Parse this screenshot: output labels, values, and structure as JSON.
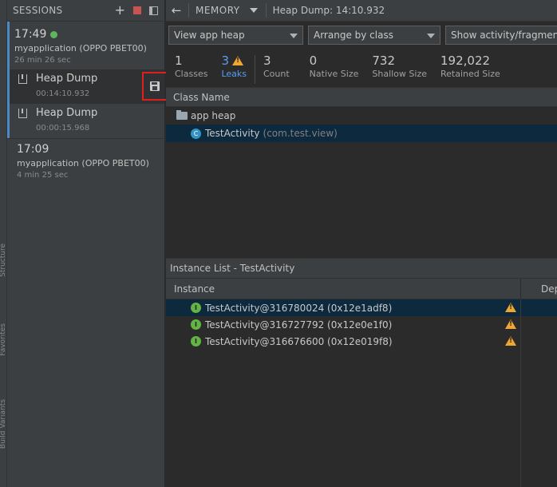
{
  "sessions_panel": {
    "title": "SESSIONS",
    "icons": [
      "plus-icon",
      "stop-icon",
      "panel-icon"
    ],
    "sessions": [
      {
        "time": "17:49",
        "device": "myapplication (OPPO PBET00)",
        "age": "26 min 26 sec",
        "live": true,
        "dumps": [
          {
            "title": "Heap Dump",
            "duration": "00:14:10.932"
          },
          {
            "title": "Heap Dump",
            "duration": "00:00:15.968"
          }
        ]
      },
      {
        "time": "17:09",
        "device": "myapplication (OPPO PBET00)",
        "age": "4 min 25 sec"
      }
    ]
  },
  "toolbar": {
    "profiler": "MEMORY",
    "dump_title": "Heap Dump: 14:10.932"
  },
  "filters": {
    "heap": "View app heap",
    "arrange": "Arrange by class",
    "activity": "Show activity/fragment Leaks"
  },
  "stats": [
    {
      "value": "1",
      "label": "Classes"
    },
    {
      "value": "3",
      "label": "Leaks",
      "warning": true
    },
    {
      "value": "3",
      "label": "Count"
    },
    {
      "value": "0",
      "label": "Native Size"
    },
    {
      "value": "732",
      "label": "Shallow Size"
    },
    {
      "value": "192,022",
      "label": "Retained Size"
    }
  ],
  "class_table": {
    "header": "Class Name",
    "group": "app heap",
    "class_name": "TestActivity",
    "class_package": "(com.test.view)"
  },
  "instance_list": {
    "title": "Instance List - TestActivity",
    "columns": [
      "Instance",
      "Dep"
    ],
    "rows": [
      "TestActivity@316780024 (0x12e1adf8)",
      "TestActivity@316727792 (0x12e0e1f0)",
      "TestActivity@316676600 (0x12e019f8)"
    ]
  },
  "colors": {
    "accent": "#4a88c7",
    "selection": "#0d293e",
    "warning": "#f0a732",
    "live": "#5fb55f",
    "highlight_box": "#e02020"
  }
}
